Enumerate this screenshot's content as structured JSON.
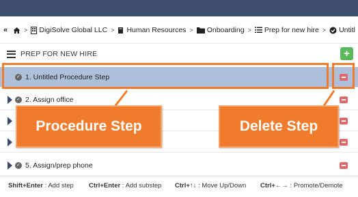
{
  "breadcrumb": {
    "items": [
      {
        "label": "DigiSolve Global LLC",
        "icon": "building-icon"
      },
      {
        "label": "Human Resources",
        "icon": "book-icon"
      },
      {
        "label": "Onboarding",
        "icon": "folder-icon"
      },
      {
        "label": "Prep for new hire",
        "icon": "list-icon"
      },
      {
        "label": "Untitl",
        "icon": "check-circle-icon"
      }
    ]
  },
  "section": {
    "title": "PREP FOR NEW HIRE"
  },
  "steps": [
    {
      "label": "1.  Untitled Procedure Step"
    },
    {
      "label": "2.  Assign office"
    },
    {
      "label": "5.  Assign/prep phone"
    }
  ],
  "callouts": {
    "procedure_step": "Procedure Step",
    "delete_step": "Delete Step"
  },
  "shortcuts": [
    {
      "keys": "Shift+Enter",
      "action": " : Add step"
    },
    {
      "keys": "Ctrl+Enter",
      "action": " : Add substep"
    },
    {
      "keys": "Ctrl+↑↓",
      "action": " : Move Up/Down"
    },
    {
      "keys": "Ctrl+←→",
      "action": " : Promote/Demote"
    }
  ],
  "colors": {
    "topbar": "#3f4f6d",
    "selected_row": "#aebfd9",
    "annotation": "#f07b2c",
    "add": "#5cb85c",
    "delete": "#e06a6a"
  }
}
